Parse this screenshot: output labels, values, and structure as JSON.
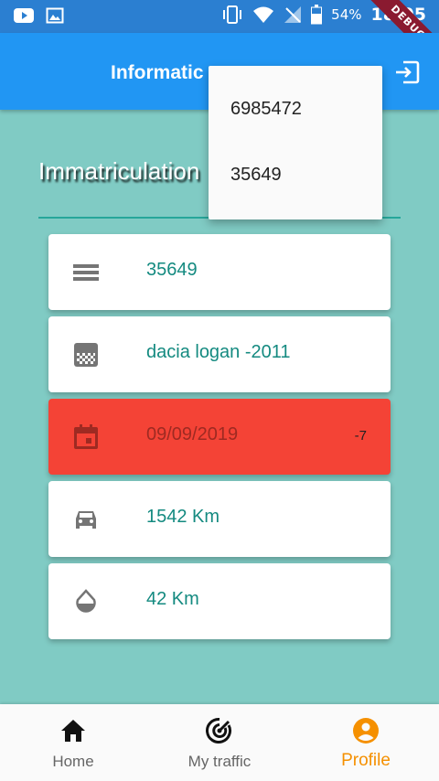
{
  "status_bar": {
    "battery": "54%",
    "time": "18:05",
    "debug_label": "DEBUG"
  },
  "app_bar": {
    "title": "Informatic"
  },
  "plate_label": "Immatriculation",
  "dropdown": {
    "items": [
      "6985472",
      "35649"
    ]
  },
  "cards": [
    {
      "icon": "plate-lines-icon",
      "text": "35649",
      "trailing": ""
    },
    {
      "icon": "model-icon",
      "text": "dacia logan -2011",
      "trailing": ""
    },
    {
      "icon": "calendar-icon",
      "text": "09/09/2019",
      "trailing": "-7",
      "status_color": "#f44336"
    },
    {
      "icon": "car-icon",
      "text": "1542 Km",
      "trailing": ""
    },
    {
      "icon": "drop-icon",
      "text": "42 Km",
      "trailing": ""
    }
  ],
  "bottom_nav": {
    "items": [
      {
        "label": "Home",
        "icon": "home-icon"
      },
      {
        "label": "My traffic",
        "icon": "radar-icon"
      },
      {
        "label": "Profile",
        "icon": "account-circle-icon",
        "active": true
      }
    ],
    "active_color": "#f59000"
  },
  "colors": {
    "status_bar": "#2b7fd1",
    "app_bar": "#2196f3",
    "background": "#80cbc4",
    "accent_text": "#148a80",
    "alert": "#f44336"
  }
}
